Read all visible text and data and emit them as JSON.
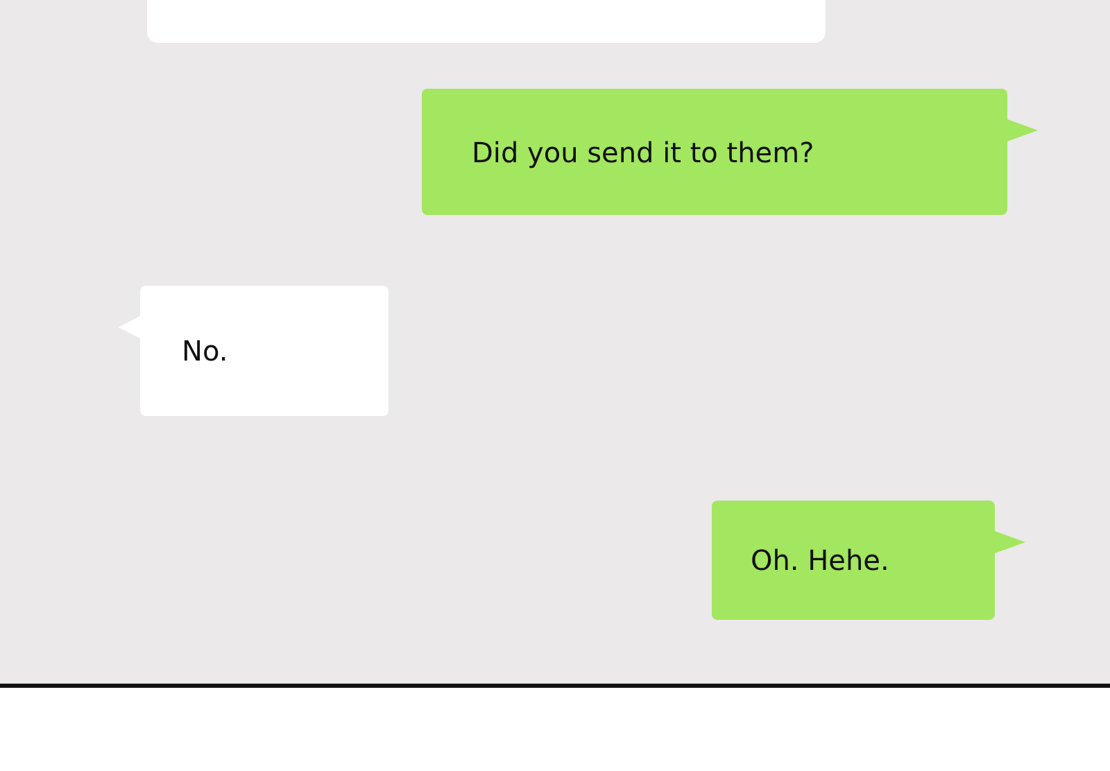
{
  "messages": [
    {
      "kind": "cutoff"
    },
    {
      "kind": "outgoing",
      "text": "Did you send it to them?"
    },
    {
      "kind": "incoming",
      "text": "No."
    },
    {
      "kind": "outgoing",
      "text": "Oh. Hehe."
    }
  ]
}
